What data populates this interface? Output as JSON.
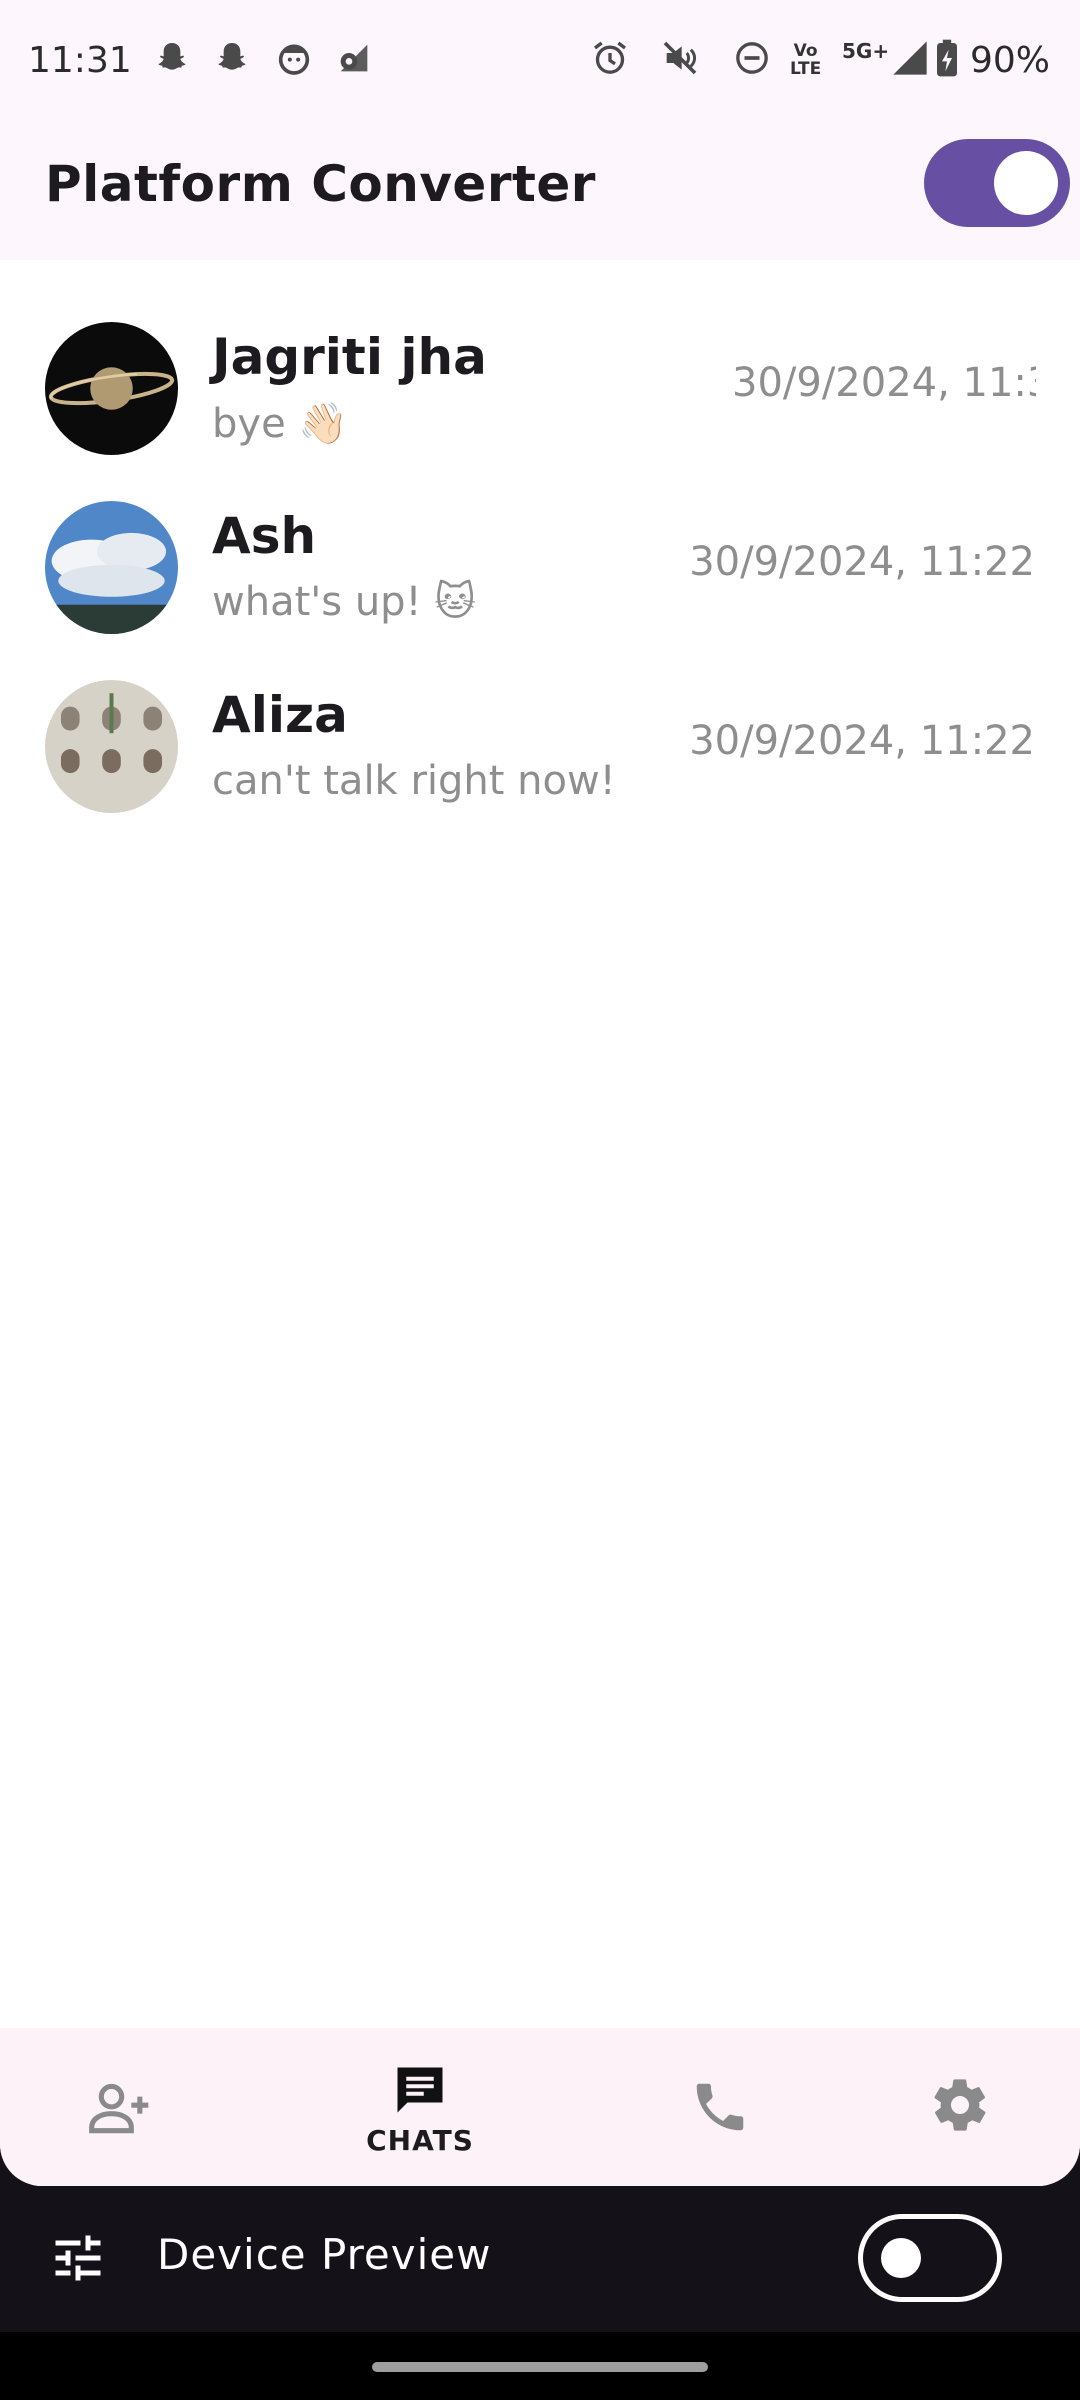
{
  "status_bar": {
    "time": "11:31",
    "network_label": "5G+",
    "volte_top": "Vo",
    "volte_bottom": "LTE",
    "battery": "90%",
    "icons": [
      "snapchat-icon",
      "snapchat-icon",
      "face-icon",
      "settings-wifi-icon",
      "alarm-icon",
      "mute-icon",
      "do-not-disturb-icon",
      "volte-icon",
      "5g-icon",
      "signal-icon",
      "battery-charging-icon"
    ]
  },
  "app_bar": {
    "title": "Platform Converter",
    "toggle_on": true
  },
  "chats": [
    {
      "name": "Jagriti jha",
      "message": "bye 👋🏻",
      "time": "30/9/2024, 11:3",
      "avatar": "saturn-avatar"
    },
    {
      "name": "Ash",
      "message": "what's up! 🐱",
      "time": "30/9/2024, 11:22",
      "avatar": "sky-avatar"
    },
    {
      "name": "Aliza",
      "message": "can't talk right now!",
      "time": "30/9/2024, 11:22",
      "avatar": "shelf-avatar"
    }
  ],
  "bottom_nav": {
    "items": [
      {
        "icon": "add-person-icon",
        "label": ""
      },
      {
        "icon": "chat-icon",
        "label": "CHATS",
        "active": true
      },
      {
        "icon": "phone-icon",
        "label": ""
      },
      {
        "icon": "settings-icon",
        "label": ""
      }
    ]
  },
  "device_preview": {
    "label": "Device Preview",
    "toggle_on": false
  },
  "colors": {
    "accent": "#6750a4",
    "surface": "#fdf7fd",
    "nav_background": "#fdf2f8",
    "preview_bar": "#141218"
  }
}
